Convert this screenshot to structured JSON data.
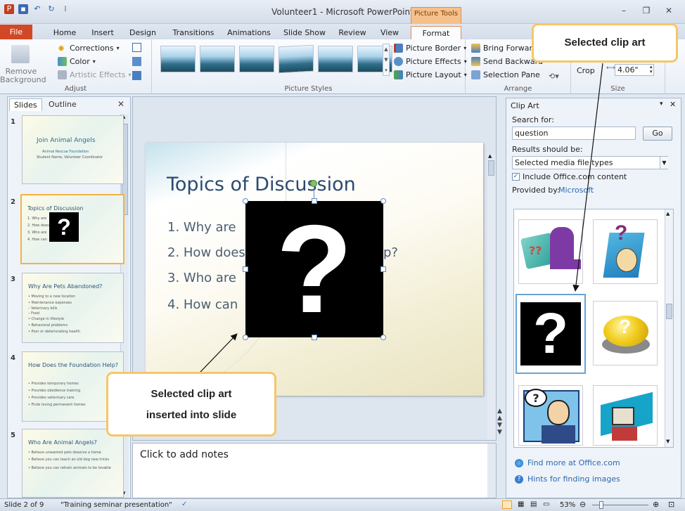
{
  "window": {
    "title": "Volunteer1 - Microsoft PowerPoint",
    "context_tab": "Picture Tools"
  },
  "tabs": [
    "File",
    "Home",
    "Insert",
    "Design",
    "Transitions",
    "Animations",
    "Slide Show",
    "Review",
    "View",
    "Format"
  ],
  "ribbon": {
    "adjust": {
      "remove_bg_l1": "Remove",
      "remove_bg_l2": "Background",
      "corrections": "Corrections",
      "color": "Color",
      "artistic": "Artistic Effects",
      "label": "Adjust"
    },
    "styles": {
      "label": "Picture Styles",
      "border": "Picture Border",
      "effects": "Picture Effects",
      "layout": "Picture Layout"
    },
    "arrange": {
      "bring_forward": "Bring Forward",
      "send_backward": "Send Backward",
      "selection_pane": "Selection Pane",
      "label": "Arrange"
    },
    "size": {
      "crop": "Crop",
      "width_value": "4.06\"",
      "label": "Size"
    }
  },
  "leftpane": {
    "tab_slides": "Slides",
    "tab_outline": "Outline",
    "slides": [
      {
        "num": "1",
        "title": "Join Animal Angels",
        "lines": [
          "Animal Rescue Foundation",
          "Student Name, Volunteer Coordinator"
        ]
      },
      {
        "num": "2",
        "title": "Topics of Discussion",
        "lines": [
          "1. Why are",
          "2. How does",
          "3. Who are",
          "4. How can"
        ]
      },
      {
        "num": "3",
        "title": "Why Are Pets Abandoned?",
        "lines": [
          "• Moving to a new location",
          "• Maintenance expenses",
          "   – Veterinary bills",
          "   – Food",
          "• Change in lifestyle",
          "• Behavioral problems",
          "• Poor or deteriorating health"
        ]
      },
      {
        "num": "4",
        "title": "How Does the Foundation Help?",
        "lines": [
          "• Provides temporary homes",
          "• Provides obedience training",
          "• Provides veterinary care",
          "• Finds loving permanent homes"
        ]
      },
      {
        "num": "5",
        "title": "Who Are Animal Angels?",
        "lines": [
          "• Believe unwanted pets deserve a home",
          "• Believe you can teach an old dog new tricks",
          "• Believe you can retrain animals to be lovable"
        ]
      }
    ]
  },
  "slide": {
    "title": "Topics of Discussion",
    "bullets": [
      "1. Why are",
      "2. How does",
      "3. Who are",
      "4. How can"
    ],
    "bullet2_tail": "p?",
    "clip_glyph": "?"
  },
  "notes": {
    "placeholder": "Click to add notes"
  },
  "clipart_pane": {
    "title": "Clip Art",
    "search_label": "Search for:",
    "search_value": "question",
    "go_label": "Go",
    "results_label": "Results should be:",
    "results_value": "Selected media file types",
    "include_label": "Include Office.com content",
    "include_checked": true,
    "provided_label": "Provided by:",
    "provided_value": "Microsoft",
    "find_more": "Find more at Office.com",
    "hints": "Hints for finding images"
  },
  "status": {
    "slide_info": "Slide 2 of 9",
    "theme": "\"Training seminar presentation\"",
    "zoom": "53%"
  },
  "callouts": {
    "top_right": "Selected clip art",
    "bottom_line1": "Selected clip art",
    "bottom_line2": "inserted into slide"
  },
  "colors": {
    "file_tab": "#d24726",
    "callout_border": "#f6c667",
    "context_tab": "#f6c08d"
  }
}
